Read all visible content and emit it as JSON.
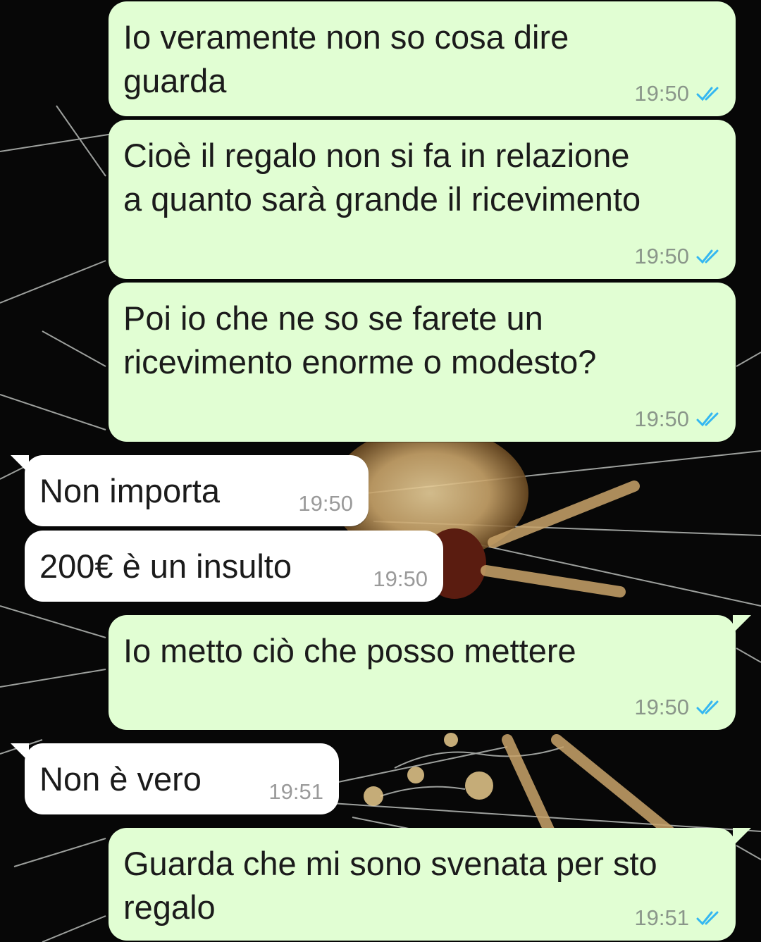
{
  "colors": {
    "outgoing_bubble": "#e1fed3",
    "incoming_bubble": "#ffffff",
    "read_ticks": "#34b7f1",
    "timestamp": "#8a968a"
  },
  "messages": [
    {
      "direction": "out",
      "text": "Io veramente non so cosa dire\nguarda",
      "time": "19:50",
      "status_icon": "double-check-read-icon"
    },
    {
      "direction": "out",
      "text": "Cioè il regalo non si fa in relazione\na quanto sarà grande il ricevimento",
      "time": "19:50",
      "status_icon": "double-check-read-icon"
    },
    {
      "direction": "out",
      "text": "Poi io che ne so se farete un\nricevimento enorme o modesto?",
      "time": "19:50",
      "status_icon": "double-check-read-icon"
    },
    {
      "direction": "in",
      "text": "Non importa",
      "time": "19:50"
    },
    {
      "direction": "in",
      "text": "200€ è un insulto",
      "time": "19:50"
    },
    {
      "direction": "out",
      "text": "Io metto ciò che posso mettere",
      "time": "19:50",
      "status_icon": "double-check-read-icon"
    },
    {
      "direction": "in",
      "text": "Non è vero",
      "time": "19:51"
    },
    {
      "direction": "out",
      "text": "Guarda che mi sono svenata per sto\nregalo",
      "time": "19:51",
      "status_icon": "double-check-read-icon"
    }
  ]
}
